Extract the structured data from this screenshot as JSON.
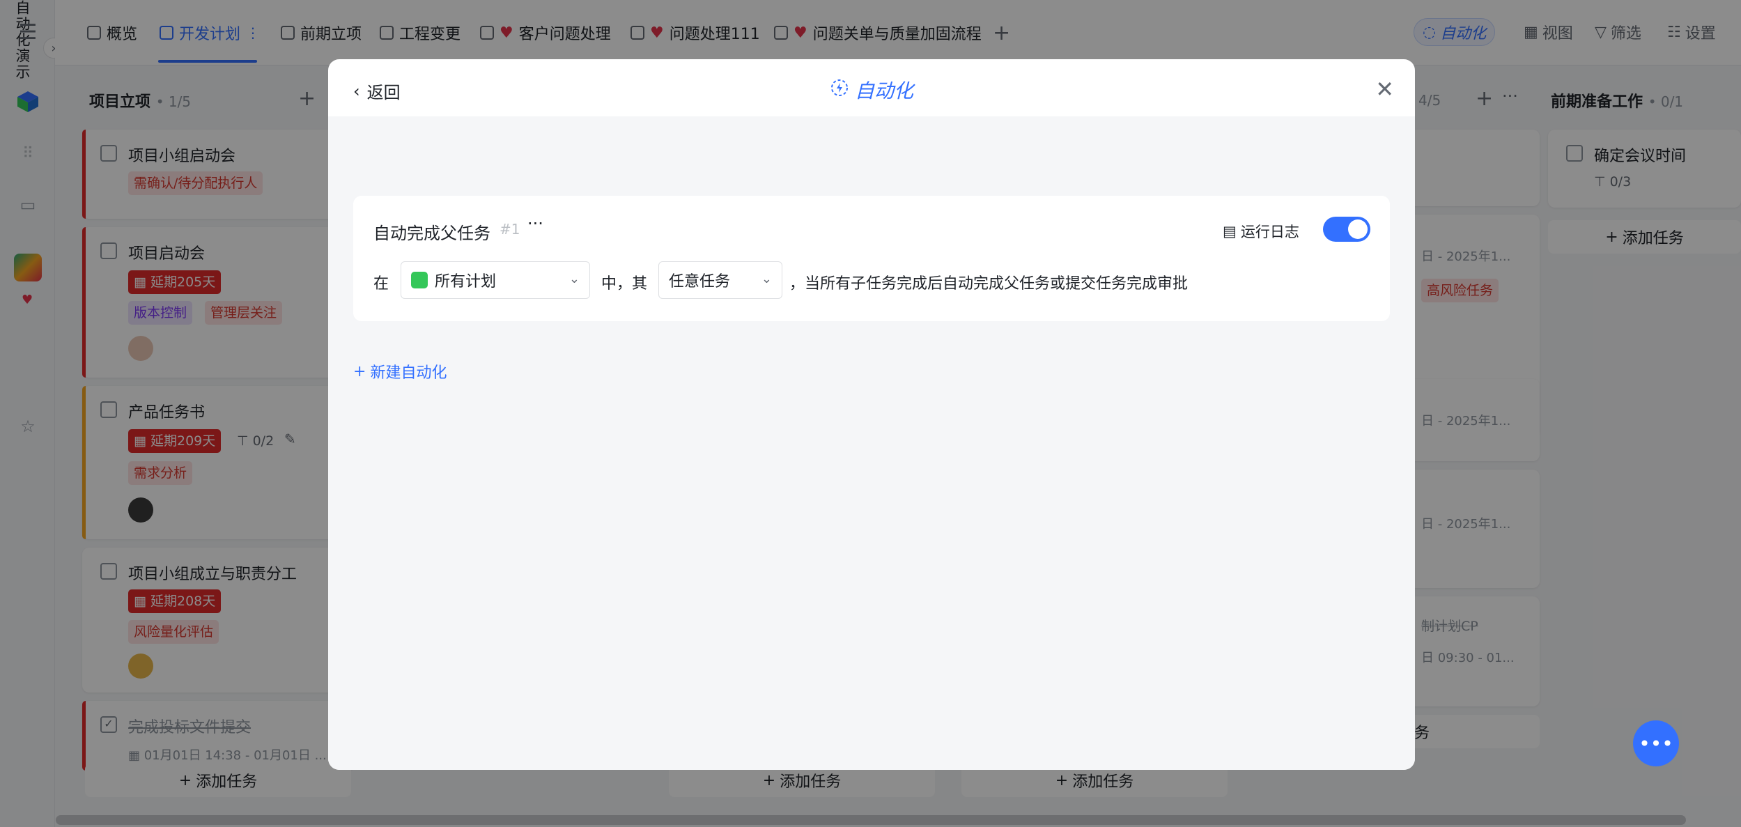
{
  "tabs": [
    {
      "label": "概览",
      "active": false
    },
    {
      "label": "开发计划",
      "active": true
    },
    {
      "label": "前期立项",
      "active": false
    },
    {
      "label": "工程变更",
      "active": false
    },
    {
      "label": "客户问题处理",
      "active": false,
      "heart": true
    },
    {
      "label": "问题处理111",
      "active": false,
      "heart": true
    },
    {
      "label": "问题关单与质量加固流程",
      "active": false,
      "heart": true
    }
  ],
  "toolbar": {
    "automation": "自动化",
    "view": "视图",
    "filter": "筛选",
    "settings": "设置"
  },
  "sidebar": {
    "project_name": "自动化演示"
  },
  "board": {
    "col1": {
      "title": "项目立项",
      "count": "• 1/5",
      "cards": [
        {
          "title": "项目小组启动会",
          "tags": [
            "需确认/待分配执行人"
          ],
          "bar": "#e02a2a"
        },
        {
          "title": "项目启动会",
          "delay": "延期205天",
          "tags": [
            "版本控制",
            "管理层关注"
          ],
          "bar": "#e02a2a"
        },
        {
          "title": "产品任务书",
          "delay": "延期209天",
          "subtasks": "0/2",
          "tags": [
            "需求分析"
          ],
          "bar": "#f5a623"
        },
        {
          "title": "项目小组成立与职责分工",
          "delay": "延期208天",
          "tags": [
            "风险量化评估"
          ],
          "bar": "#ffffff"
        },
        {
          "title": "完成投标文件提交",
          "date": "01月01日 14:38 - 01月01日 ...",
          "bar": "#e02a2a"
        }
      ]
    },
    "col_mid": {
      "count": "4/5",
      "snippets": [
        "日 - 2025年1...",
        "高风险任务",
        "日 - 2025年1...",
        "日 - 2025年1...",
        "制计划CP",
        "日 09:30 - 01...",
        "务"
      ]
    },
    "col_right": {
      "title": "前期准备工作",
      "count": "• 0/1",
      "cards": [
        {
          "title": "确定会议时间",
          "subtasks": "0/3"
        }
      ]
    },
    "add_task": "添加任务"
  },
  "modal": {
    "back": "返回",
    "title": "自动化",
    "rule": {
      "name": "自动完成父任务",
      "number": "#1",
      "more": "···",
      "run_log": "运行日志",
      "enabled": true,
      "in_label": "在",
      "plan_select": "所有计划",
      "middle_label": "中，其",
      "task_select": "任意任务",
      "description": "，当所有子任务完成后自动完成父任务或提交任务完成审批"
    },
    "new_automation": "新建自动化"
  },
  "colors": {
    "accent": "#3370ff",
    "danger": "#e02a2a"
  }
}
